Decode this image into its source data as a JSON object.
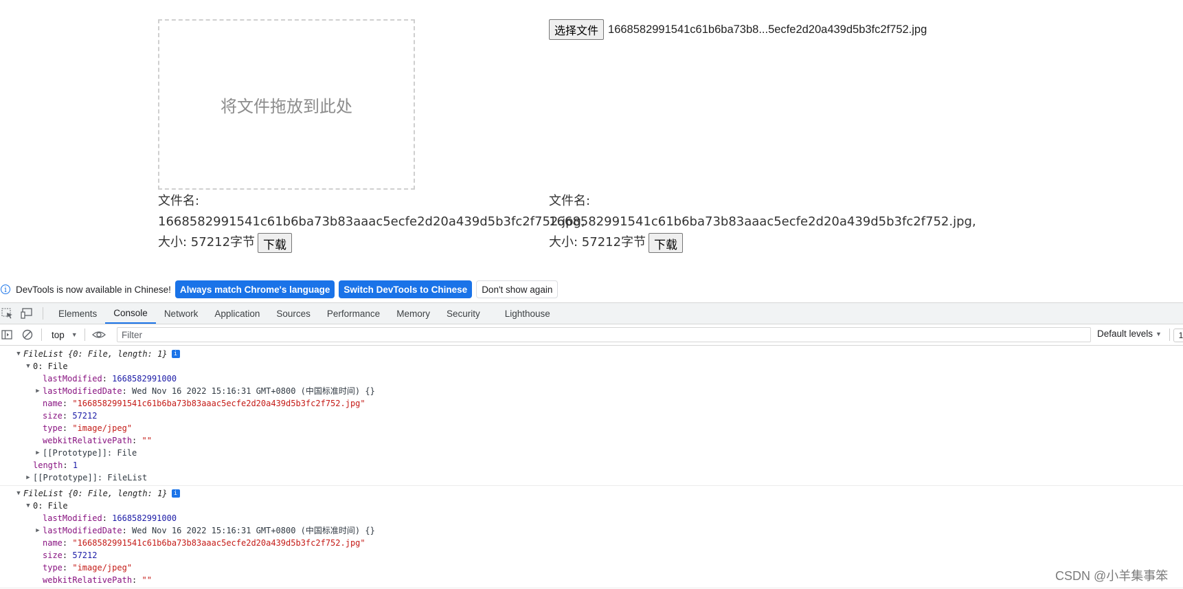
{
  "page": {
    "drop_zone_text": "将文件拖放到此处",
    "choose_file_label": "选择文件",
    "chosen_file_display": "1668582991541c61b6ba73b8...5ecfe2d20a439d5b3fc2f752.jpg",
    "left_info": {
      "name_label": "文件名:",
      "file_name": "1668582991541c61b6ba73b83aaac5ecfe2d20a439d5b3fc2f752.jpg,",
      "size_text": "大小: 57212字节",
      "download_label": "下载"
    },
    "right_info": {
      "name_label": "文件名:",
      "file_name": "1668582991541c61b6ba73b83aaac5ecfe2d20a439d5b3fc2f752.jpg,",
      "size_text": "大小: 57212字节",
      "download_label": "下载"
    }
  },
  "devtools": {
    "banner": {
      "message": "DevTools is now available in Chinese!",
      "btn_match": "Always match Chrome's language",
      "btn_switch": "Switch DevTools to Chinese",
      "btn_dismiss": "Don't show again"
    },
    "tabs": [
      "Elements",
      "Console",
      "Network",
      "Application",
      "Sources",
      "Performance",
      "Memory",
      "Security",
      "Lighthouse"
    ],
    "active_tab": "Console",
    "context": "top",
    "filter_placeholder": "Filter",
    "levels_label": "Default levels",
    "issues_count": "1",
    "log_groups": [
      {
        "header": "FileList {0: File, length: 1}",
        "item_label": "0: File",
        "lastModified_key": "lastModified",
        "lastModified": "1668582991000",
        "lastModifiedDate_key": "lastModifiedDate",
        "lastModifiedDate": "Wed Nov 16 2022 15:16:31 GMT+0800 (中国标准时间) {}",
        "name_key": "name",
        "name": "\"1668582991541c61b6ba73b83aaac5ecfe2d20a439d5b3fc2f752.jpg\"",
        "size_key": "size",
        "size": "57212",
        "type_key": "type",
        "type": "\"image/jpeg\"",
        "webkitRelativePath_key": "webkitRelativePath",
        "webkitRelativePath": "\"\"",
        "proto_file": "[[Prototype]]: File",
        "length_key": "length",
        "length": "1",
        "proto_list": "[[Prototype]]: FileList"
      },
      {
        "header": "FileList {0: File, length: 1}",
        "item_label": "0: File",
        "lastModified_key": "lastModified",
        "lastModified": "1668582991000",
        "lastModifiedDate_key": "lastModifiedDate",
        "lastModifiedDate": "Wed Nov 16 2022 15:16:31 GMT+0800 (中国标准时间) {}",
        "name_key": "name",
        "name": "\"1668582991541c61b6ba73b83aaac5ecfe2d20a439d5b3fc2f752.jpg\"",
        "size_key": "size",
        "size": "57212",
        "type_key": "type",
        "type": "\"image/jpeg\"",
        "webkitRelativePath_key": "webkitRelativePath",
        "webkitRelativePath": "\"\""
      }
    ]
  },
  "watermark": "CSDN @小羊集事笨",
  "icons": [
    "inspect-icon",
    "device-toolbar-icon",
    "sidebar-toggle-icon",
    "clear-console-icon",
    "eye-icon",
    "info-icon"
  ],
  "colors": {
    "accent": "#1a73e8",
    "console_key": "#881280",
    "console_number": "#1a1aa6",
    "console_string": "#c41a16"
  }
}
